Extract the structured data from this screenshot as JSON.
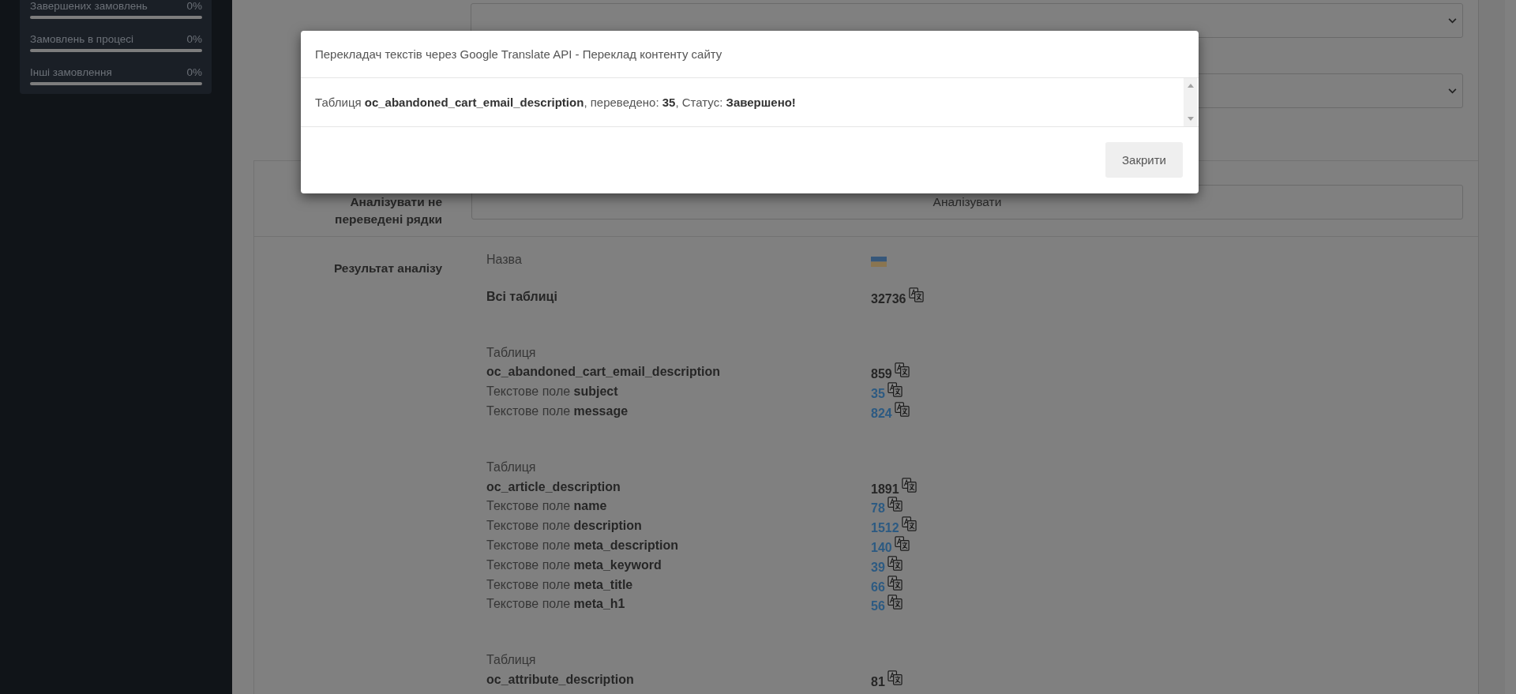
{
  "sidebar": {
    "stats": [
      {
        "label": "Завершених замовлень",
        "value": "0%"
      },
      {
        "label": "Замовлень в процесі",
        "value": "0%"
      },
      {
        "label": "Інші замовлення",
        "value": "0%"
      }
    ]
  },
  "form": {
    "dropdowns": [
      {
        "kind": "select"
      },
      {
        "kind": "select"
      }
    ],
    "analyze": {
      "label": "Аналізувати не переведені рядки",
      "button": "Аналізувати"
    },
    "result": {
      "label": "Результат аналізу",
      "header": "Назва",
      "sections": [
        {
          "kind": "total",
          "name": "Всі таблиці",
          "count": "32736"
        },
        {
          "kind": "table",
          "caption": "Таблиця",
          "name": "oc_abandoned_cart_email_description",
          "count": "859",
          "fields": [
            {
              "name": "Текстове поле **subject**",
              "count": "35"
            },
            {
              "name": "Текстове поле **message**",
              "count": "824"
            }
          ]
        },
        {
          "kind": "table",
          "caption": "Таблиця",
          "name": "oc_article_description",
          "count": "1891",
          "fields": [
            {
              "name": "Текстове поле **name**",
              "count": "78"
            },
            {
              "name": "Текстове поле **description**",
              "count": "1512"
            },
            {
              "name": "Текстове поле **meta_description**",
              "count": "140"
            },
            {
              "name": "Текстове поле **meta_keyword**",
              "count": "39"
            },
            {
              "name": "Текстове поле **meta_title**",
              "count": "66"
            },
            {
              "name": "Текстове поле **meta_h1**",
              "count": "56"
            }
          ]
        },
        {
          "kind": "table",
          "caption": "Таблиця",
          "name": "oc_attribute_description",
          "count": "81"
        }
      ]
    }
  },
  "modal": {
    "title": "Перекладач текстів через Google Translate API - Переклад контенту сайту",
    "message": "Таблиця **oc_abandoned_cart_email_description**, переведено: **35**, Статус: **Завершено!**",
    "close_button": "Закрити"
  }
}
